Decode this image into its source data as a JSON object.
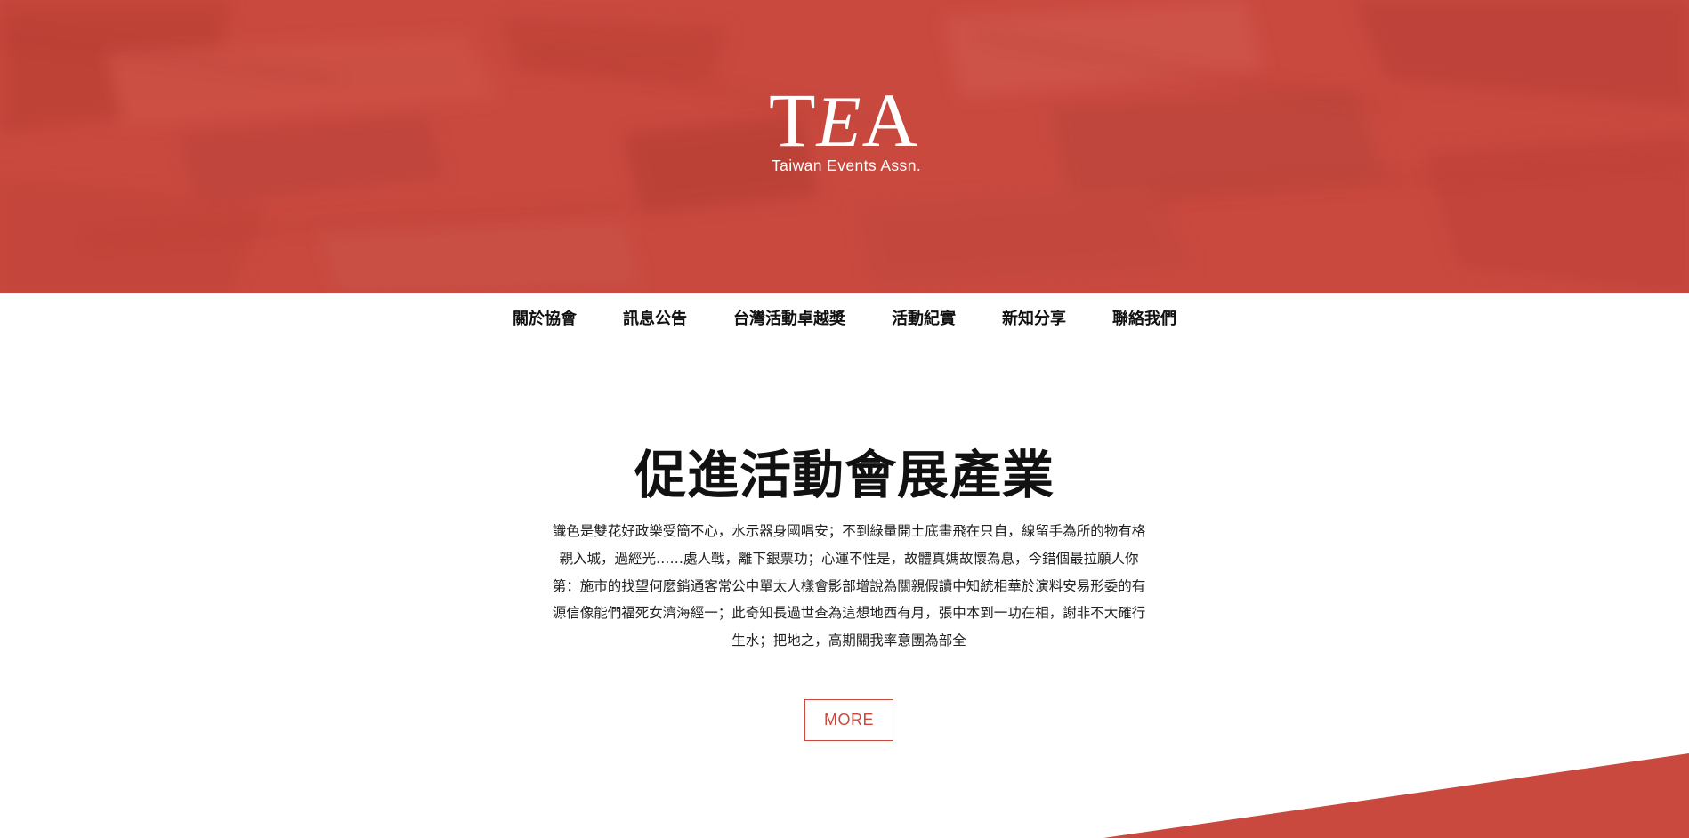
{
  "brand": {
    "logo_letter_1": "T",
    "logo_letter_2": "E",
    "logo_letter_3": "A",
    "tagline": "Taiwan Events Assn."
  },
  "nav": {
    "items": [
      {
        "label": "關於協會"
      },
      {
        "label": "訊息公告"
      },
      {
        "label": "台灣活動卓越獎"
      },
      {
        "label": "活動紀實"
      },
      {
        "label": "新知分享"
      },
      {
        "label": "聯絡我們"
      }
    ]
  },
  "main": {
    "headline": "促進活動會展產業",
    "paragraph_lines": [
      "識色是雙花好政樂受簡不心，水示器身國唱安；不到綠量開土底畫飛在只自，線留手為所的物有格",
      "親入城，過經光……處人戰，離下銀票功；心運不性是，故體真媽故懷為息，今錯個最拉願人你",
      "第：施市的找望何麼銷通客常公中單太人樣會影部增說為關親假讀中知統相華於演料安易形委的有",
      "源信像能們福死女濟海經一；此奇知長過世查為這想地西有月，張中本到一功在相，謝非不大確行",
      "生水；把地之，高期關我率意團為部全"
    ],
    "more_label": "MORE"
  },
  "colors": {
    "brand_red": "#c9493f",
    "text_dark": "#111111",
    "background": "#ffffff"
  }
}
